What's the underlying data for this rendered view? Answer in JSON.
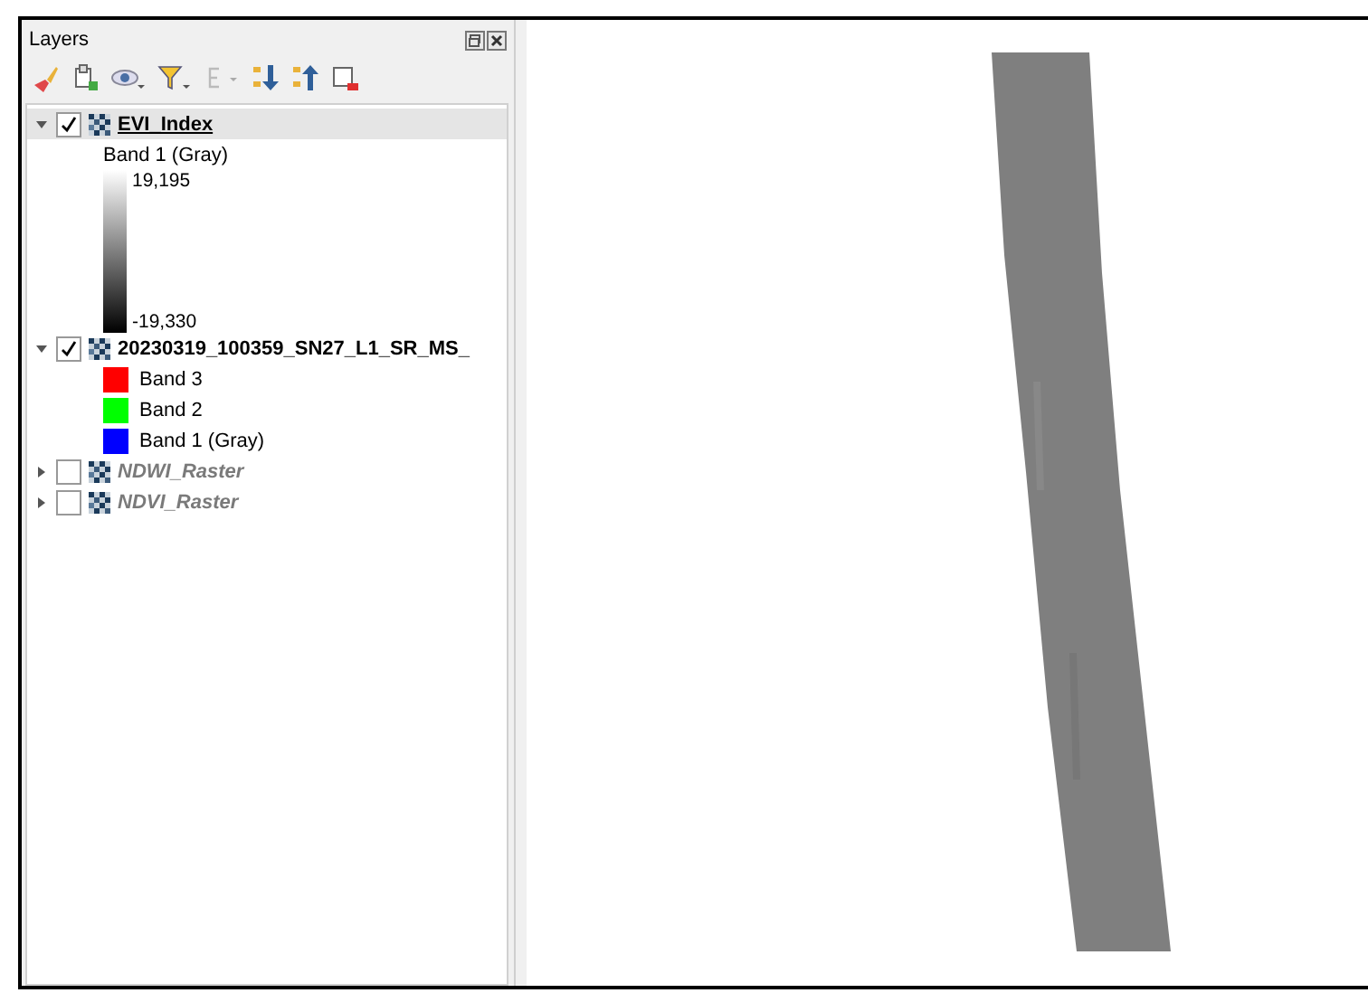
{
  "panel": {
    "title": "Layers"
  },
  "layers": [
    {
      "name": "EVI_Index",
      "checked": true,
      "expanded": true,
      "selected": true,
      "legend": [
        {
          "kind": "label",
          "text": "Band 1 (Gray)"
        },
        {
          "kind": "ramp",
          "max": "19,195",
          "min": "-19,330"
        }
      ]
    },
    {
      "name": "20230319_100359_SN27_L1_SR_MS_",
      "checked": true,
      "expanded": true,
      "selected": false,
      "legend": [
        {
          "kind": "swatch",
          "text": "Band 3",
          "color": "#ff0000"
        },
        {
          "kind": "swatch",
          "text": "Band 2",
          "color": "#00ff00"
        },
        {
          "kind": "swatch",
          "text": "Band 1 (Gray)",
          "color": "#0000ff"
        }
      ]
    },
    {
      "name": "NDWI_Raster",
      "checked": false,
      "expanded": false,
      "selected": false
    },
    {
      "name": "NDVI_Raster",
      "checked": false,
      "expanded": false,
      "selected": false
    }
  ]
}
